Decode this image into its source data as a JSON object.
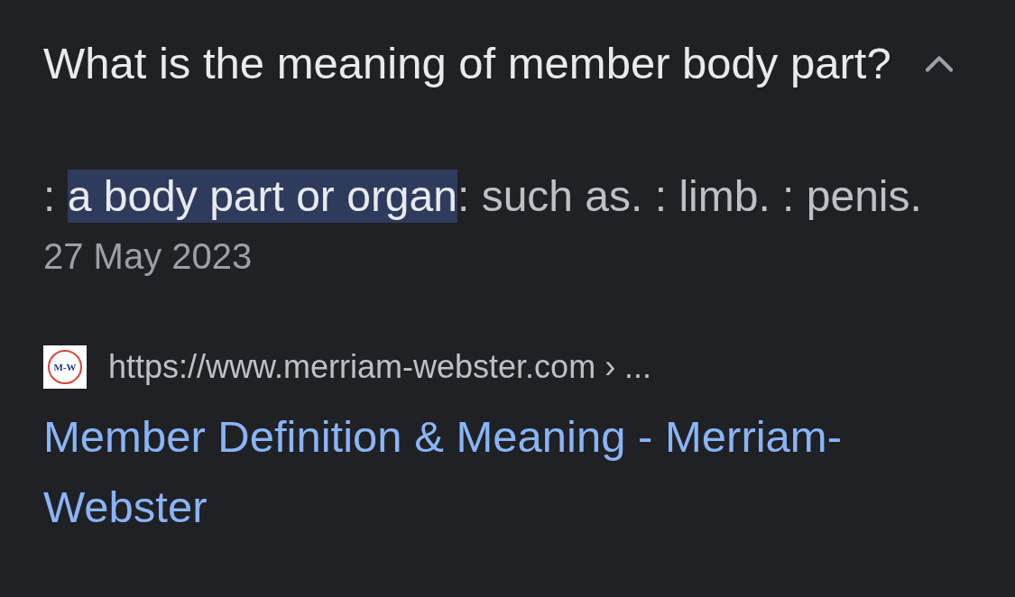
{
  "question": {
    "text": "What is the meaning of member body part?",
    "expanded": true
  },
  "answer": {
    "snippet": ": **a body part or organ**: such as. : limb. : penis.",
    "date": "27 May 2023"
  },
  "source": {
    "logo_text": "M-W",
    "url": "https://www.merriam-webster.com › ...",
    "title": "Member Definition & Meaning - Merriam-Webster"
  }
}
